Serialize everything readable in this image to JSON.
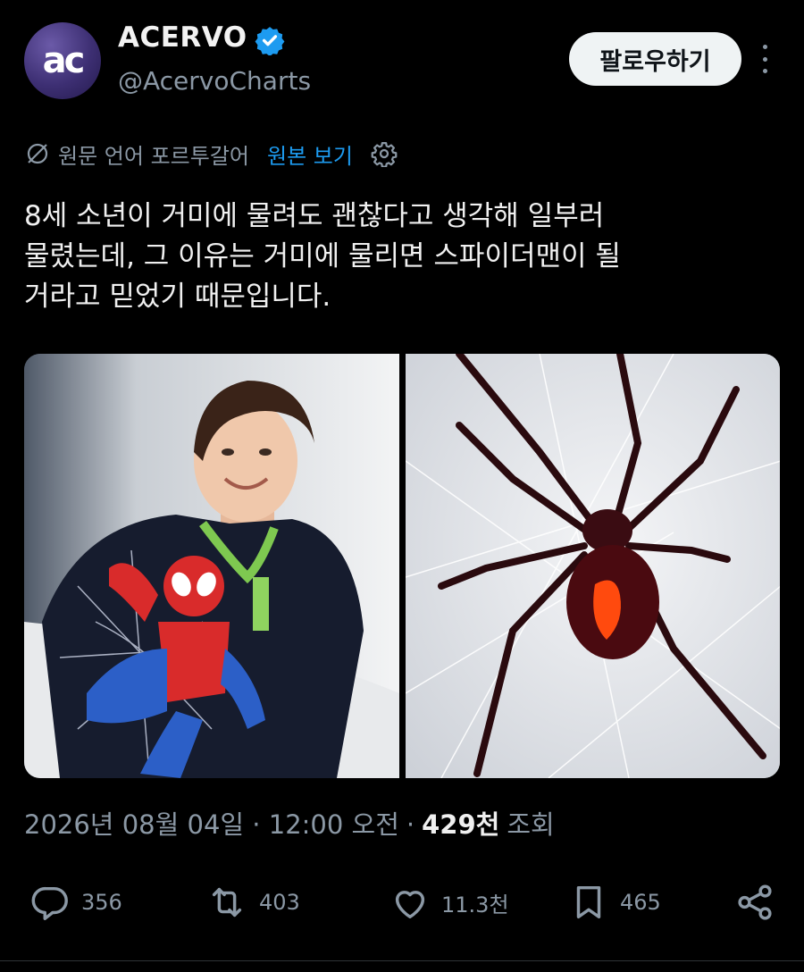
{
  "author": {
    "avatar_text": "ac",
    "display_name": "ACERVO",
    "handle": "@AcervoCharts",
    "verified": true,
    "verified_icon": "verified-badge-icon"
  },
  "header": {
    "follow_label": "팔로우하기",
    "more_icon": "more-vertical-icon"
  },
  "translation": {
    "icon": "translate-icon",
    "source_language": "원문 언어 포르투갈어",
    "view_original": "원본 보기",
    "settings_icon": "gear-icon"
  },
  "tweet": {
    "text": "8세 소년이 거미에 물려도 괜찮다고 생각해 일부러\n물렸는데, 그 이유는 거미에 물리면 스파이더맨이 될\n거라고 믿었기 때문입니다."
  },
  "media": {
    "images": [
      "boy-in-spiderman-shirt-photo",
      "red-back-spider-photo"
    ]
  },
  "meta": {
    "timestamp": "2026년 08월 04일 · 12:00 오전",
    "separator": "·",
    "views_count": "429천",
    "views_label": "조회"
  },
  "actions": {
    "reply": {
      "icon": "reply-icon",
      "count": "356"
    },
    "retweet": {
      "icon": "retweet-icon",
      "count": "403"
    },
    "like": {
      "icon": "heart-icon",
      "count": "11.3천"
    },
    "bookmark": {
      "icon": "bookmark-icon",
      "count": "465"
    },
    "share": {
      "icon": "share-icon"
    }
  },
  "colors": {
    "background": "#000000",
    "primary_text": "#e7e9ea",
    "secondary_text": "#8b98a5",
    "link": "#1d9bf0",
    "verified": "#1d9bf0"
  }
}
